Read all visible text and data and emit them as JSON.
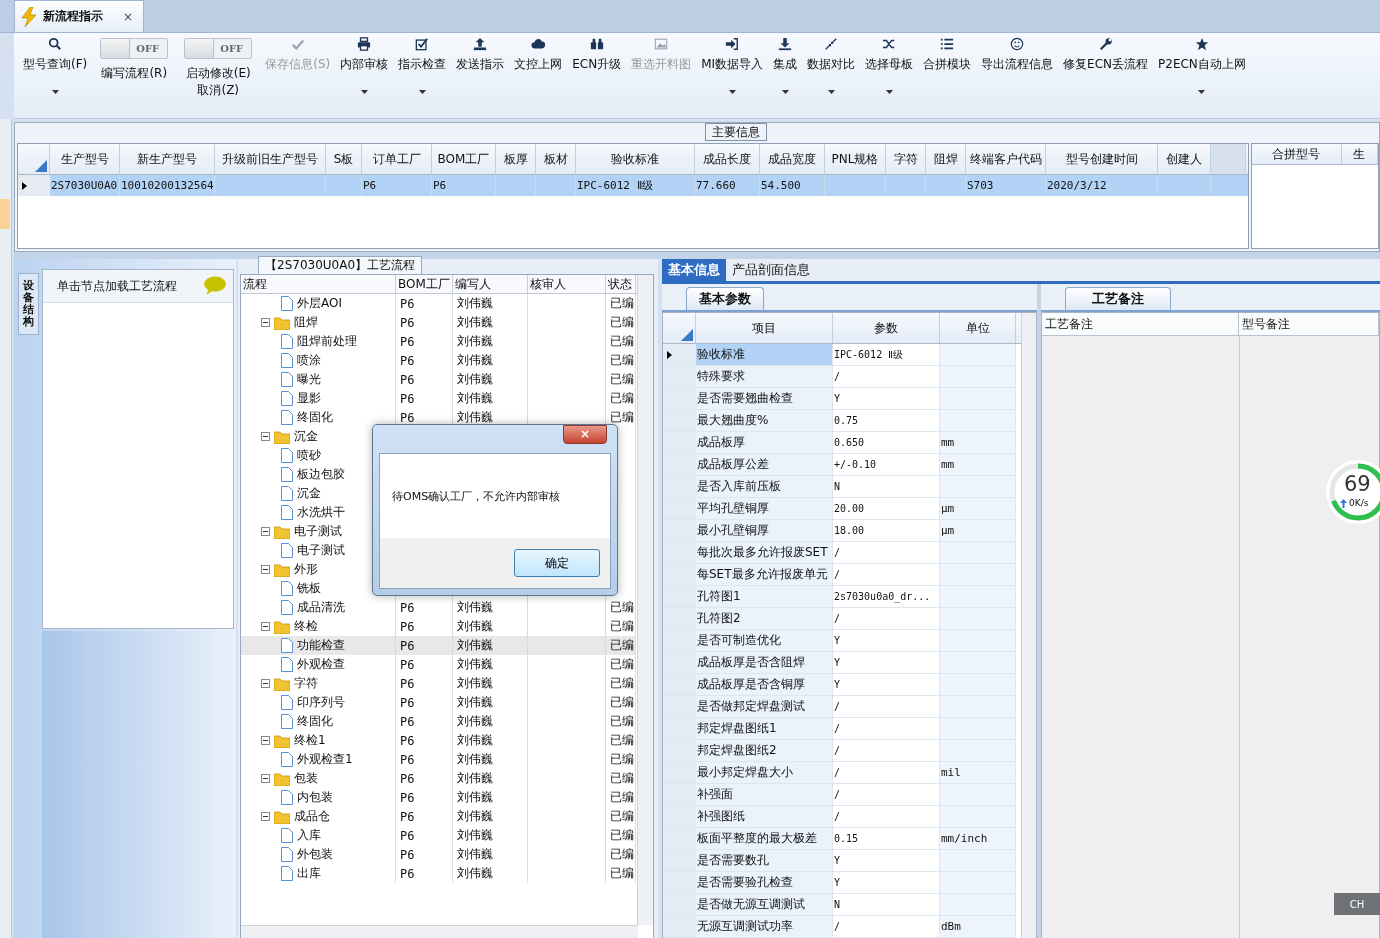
{
  "tab": {
    "title": "新流程指示",
    "close": "×"
  },
  "toolbar": [
    {
      "kind": "button",
      "label": "型号查询(F)",
      "disabled": false,
      "dropdown": true
    },
    {
      "kind": "toggle",
      "label": "编写流程(R)",
      "state_text": "OFF",
      "on": false
    },
    {
      "kind": "toggle",
      "label": "启动修改(E)\n取消(Z)",
      "state_text": "OFF",
      "on": false
    },
    {
      "kind": "button",
      "label": "保存信息(S)",
      "disabled": true,
      "dropdown": false
    },
    {
      "kind": "button",
      "label": "内部审核",
      "disabled": false,
      "dropdown": true
    },
    {
      "kind": "button",
      "label": "指示检查",
      "disabled": false,
      "dropdown": true
    },
    {
      "kind": "button",
      "label": "发送指示",
      "disabled": false,
      "dropdown": false
    },
    {
      "kind": "button",
      "label": "文控上网",
      "disabled": false,
      "dropdown": false
    },
    {
      "kind": "button",
      "label": "ECN升级",
      "disabled": false,
      "dropdown": false
    },
    {
      "kind": "button",
      "label": "重选开料图",
      "disabled": true,
      "dropdown": false
    },
    {
      "kind": "button",
      "label": "MI数据导入",
      "disabled": false,
      "dropdown": true
    },
    {
      "kind": "button",
      "label": "集成",
      "disabled": false,
      "dropdown": true
    },
    {
      "kind": "button",
      "label": "数据对比",
      "disabled": false,
      "dropdown": true
    },
    {
      "kind": "button",
      "label": "选择母板",
      "disabled": false,
      "dropdown": true
    },
    {
      "kind": "button",
      "label": "合拼模块",
      "disabled": false,
      "dropdown": false
    },
    {
      "kind": "button",
      "label": "导出流程信息",
      "disabled": false,
      "dropdown": false
    },
    {
      "kind": "button",
      "label": "修复ECN丢流程",
      "disabled": false,
      "dropdown": false
    },
    {
      "kind": "button",
      "label": "P2ECN自动上网",
      "disabled": false,
      "dropdown": true
    }
  ],
  "main_info": {
    "title": "主要信息",
    "columns": [
      "生产型号",
      "新生产型号",
      "升级前旧生产型号",
      "S板",
      "订单工厂",
      "BOM工厂",
      "板厚",
      "板材",
      "验收标准",
      "成品长度",
      "成品宽度",
      "PNL规格",
      "字符",
      "阻焊",
      "终端客户代码",
      "型号创建时间",
      "创建人"
    ],
    "rows": [
      {
        "selected": true,
        "cells": [
          "2S7030U0A0",
          "10010200132564",
          null,
          null,
          "P6",
          "P6",
          null,
          null,
          "IPC-6012 Ⅱ级",
          "77.660",
          "54.500",
          null,
          null,
          null,
          "S703",
          "2020/3/12",
          null
        ]
      }
    ],
    "side_columns": [
      "合拼型号",
      "生"
    ]
  },
  "left_panel": {
    "vertical_tab": "设备结构",
    "header": "单击节点加载工艺流程"
  },
  "flow": {
    "title": "【2S7030U0A0】工艺流程",
    "columns": [
      "流程",
      "BOM工厂",
      "编写人",
      "核审人",
      "状态"
    ],
    "rows": [
      {
        "kind": "step",
        "name": "外层AOI",
        "bom": "P6",
        "writer": "刘伟巍",
        "status": "已编",
        "selected": false
      },
      {
        "kind": "folder",
        "name": "阻焊",
        "bom": "P6",
        "writer": "刘伟巍",
        "status": "已编",
        "selected": false,
        "expanded": true,
        "children": [
          {
            "kind": "step",
            "name": "阻焊前处理",
            "bom": "P6",
            "writer": "刘伟巍",
            "status": "已编",
            "selected": false
          },
          {
            "kind": "step",
            "name": "喷涂",
            "bom": "P6",
            "writer": "刘伟巍",
            "status": "已编",
            "selected": false
          },
          {
            "kind": "step",
            "name": "曝光",
            "bom": "P6",
            "writer": "刘伟巍",
            "status": "已编",
            "selected": false
          },
          {
            "kind": "step",
            "name": "显影",
            "bom": "P6",
            "writer": "刘伟巍",
            "status": "已编",
            "selected": false
          },
          {
            "kind": "step",
            "name": "终固化",
            "bom": "P6",
            "writer": "刘伟巍",
            "status": "已编",
            "selected": false
          }
        ]
      },
      {
        "kind": "folder",
        "name": "沉金",
        "selected": false,
        "expanded": true,
        "children": [
          {
            "kind": "step",
            "name": "喷砂",
            "selected": false
          },
          {
            "kind": "step",
            "name": "板边包胶",
            "selected": false
          },
          {
            "kind": "step",
            "name": "沉金",
            "selected": false
          },
          {
            "kind": "step",
            "name": "水洗烘干",
            "selected": false
          }
        ]
      },
      {
        "kind": "folder",
        "name": "电子测试",
        "selected": false,
        "expanded": true,
        "children": [
          {
            "kind": "step",
            "name": "电子测试",
            "selected": false
          }
        ]
      },
      {
        "kind": "folder",
        "name": "外形",
        "selected": false,
        "expanded": true,
        "children": [
          {
            "kind": "step",
            "name": "铣板",
            "selected": false
          },
          {
            "kind": "step",
            "name": "成品清洗",
            "bom": "P6",
            "writer": "刘伟巍",
            "status": "已编",
            "selected": false
          }
        ]
      },
      {
        "kind": "folder",
        "name": "终检",
        "bom": "P6",
        "writer": "刘伟巍",
        "status": "已编",
        "selected": false,
        "expanded": true,
        "children": [
          {
            "kind": "step",
            "name": "功能检查",
            "bom": "P6",
            "writer": "刘伟巍",
            "status": "已编",
            "selected": true
          },
          {
            "kind": "step",
            "name": "外观检查",
            "bom": "P6",
            "writer": "刘伟巍",
            "status": "已编",
            "selected": false
          }
        ]
      },
      {
        "kind": "folder",
        "name": "字符",
        "bom": "P6",
        "writer": "刘伟巍",
        "status": "已编",
        "selected": false,
        "expanded": true,
        "children": [
          {
            "kind": "step",
            "name": "印序列号",
            "bom": "P6",
            "writer": "刘伟巍",
            "status": "已编",
            "selected": false
          },
          {
            "kind": "step",
            "name": "终固化",
            "bom": "P6",
            "writer": "刘伟巍",
            "status": "已编",
            "selected": false
          }
        ]
      },
      {
        "kind": "folder",
        "name": "终检1",
        "bom": "P6",
        "writer": "刘伟巍",
        "status": "已编",
        "selected": false,
        "expanded": true,
        "children": [
          {
            "kind": "step",
            "name": "外观检查1",
            "bom": "P6",
            "writer": "刘伟巍",
            "status": "已编",
            "selected": false
          }
        ]
      },
      {
        "kind": "folder",
        "name": "包装",
        "bom": "P6",
        "writer": "刘伟巍",
        "status": "已编",
        "selected": false,
        "expanded": true,
        "children": [
          {
            "kind": "step",
            "name": "内包装",
            "bom": "P6",
            "writer": "刘伟巍",
            "status": "已编",
            "selected": false
          }
        ]
      },
      {
        "kind": "folder",
        "name": "成品仓",
        "bom": "P6",
        "writer": "刘伟巍",
        "status": "已编",
        "selected": false,
        "expanded": true,
        "children": [
          {
            "kind": "step",
            "name": "入库",
            "bom": "P6",
            "writer": "刘伟巍",
            "status": "已编",
            "selected": false
          },
          {
            "kind": "step",
            "name": "外包装",
            "bom": "P6",
            "writer": "刘伟巍",
            "status": "已编",
            "selected": false
          },
          {
            "kind": "step",
            "name": "出库",
            "bom": "P6",
            "writer": "刘伟巍",
            "status": "已编",
            "selected": false
          }
        ]
      }
    ]
  },
  "dialog": {
    "message": "待OMS确认工厂，不允许内部审核",
    "button": "确定",
    "close": "×"
  },
  "detail_tabs": [
    {
      "label": "基本信息",
      "selected": true
    },
    {
      "label": "产品剖面信息",
      "selected": false
    }
  ],
  "params": {
    "tab": "基本参数",
    "columns": [
      "项目",
      "参数",
      "单位"
    ],
    "rows": [
      {
        "item": "验收标准",
        "value": "IPC-6012 Ⅱ级",
        "selected": true
      },
      {
        "item": "特殊要求",
        "value": "/",
        "selected": false
      },
      {
        "item": "是否需要翘曲检查",
        "value": "Y",
        "selected": false
      },
      {
        "item": "最大翘曲度%",
        "value": "0.75",
        "selected": false
      },
      {
        "item": "成品板厚",
        "value": "0.650",
        "unit": "mm",
        "selected": false
      },
      {
        "item": "成品板厚公差",
        "value": "+/-0.10",
        "unit": "mm",
        "selected": false
      },
      {
        "item": "是否入库前压板",
        "value": "N",
        "selected": false
      },
      {
        "item": "平均孔壁铜厚",
        "value": "20.00",
        "unit": "μm",
        "selected": false
      },
      {
        "item": "最小孔壁铜厚",
        "value": "18.00",
        "unit": "μm",
        "selected": false
      },
      {
        "item": "每批次最多允许报废SET",
        "value": "/",
        "selected": false
      },
      {
        "item": "每SET最多允许报废单元",
        "value": "/",
        "selected": false
      },
      {
        "item": "孔符图1",
        "value": "2s7030u0a0_dr...",
        "selected": false
      },
      {
        "item": "孔符图2",
        "value": "/",
        "selected": false
      },
      {
        "item": "是否可制造优化",
        "value": "Y",
        "selected": false
      },
      {
        "item": "成品板厚是否含阻焊",
        "value": "Y",
        "selected": false
      },
      {
        "item": "成品板厚是否含铜厚",
        "value": "Y",
        "selected": false
      },
      {
        "item": "是否做邦定焊盘测试",
        "value": "/",
        "selected": false
      },
      {
        "item": "邦定焊盘图纸1",
        "value": "/",
        "selected": false
      },
      {
        "item": "邦定焊盘图纸2",
        "value": "/",
        "selected": false
      },
      {
        "item": "最小邦定焊盘大小",
        "value": "/",
        "unit": "mil",
        "selected": false
      },
      {
        "item": "补强面",
        "value": "/",
        "selected": false
      },
      {
        "item": "补强图纸",
        "value": "/",
        "selected": false
      },
      {
        "item": "板面平整度的最大极差",
        "value": "0.15",
        "unit": "mm/inch",
        "selected": false
      },
      {
        "item": "是否需要数孔",
        "value": "Y",
        "selected": false
      },
      {
        "item": "是否需要验孔检查",
        "value": "Y",
        "selected": false
      },
      {
        "item": "是否做无源互调测试",
        "value": "N",
        "selected": false
      },
      {
        "item": "无源互调测试功率",
        "value": "/",
        "unit": "dBm",
        "selected": false
      }
    ]
  },
  "remarks": {
    "tab": "工艺备注",
    "columns": [
      "工艺备注",
      "型号备注"
    ]
  },
  "speed_widget": {
    "percent": "69",
    "rate": "0K/s"
  },
  "ime": "CH"
}
